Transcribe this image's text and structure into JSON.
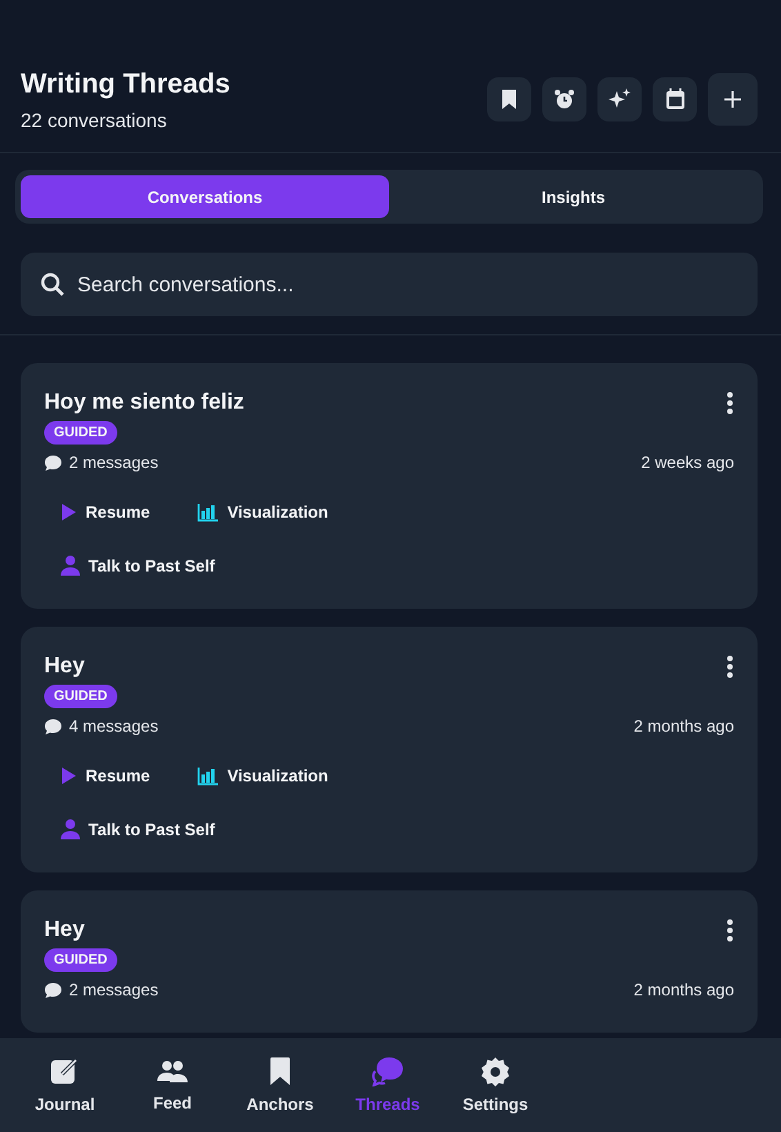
{
  "header": {
    "title": "Writing Threads",
    "subtitle": "22 conversations",
    "actions": [
      {
        "kind": "bookmark"
      },
      {
        "kind": "alarm"
      },
      {
        "kind": "sparkle"
      },
      {
        "kind": "calendar"
      },
      {
        "kind": "plus"
      }
    ]
  },
  "tabs": [
    {
      "label": "Conversations",
      "selected": true
    },
    {
      "label": "Insights",
      "selected": false
    }
  ],
  "search": {
    "placeholder": "Search conversations..."
  },
  "threads": [
    {
      "title": "Hoy me siento feliz",
      "badge": "GUIDED",
      "messages": "2 messages",
      "time": "2 weeks ago",
      "actions": [
        {
          "kind": "resume",
          "label": "Resume"
        },
        {
          "kind": "chart",
          "label": "Visualization"
        },
        {
          "kind": "person",
          "label": "Talk to Past Self"
        }
      ]
    },
    {
      "title": "Hey",
      "badge": "GUIDED",
      "messages": "4 messages",
      "time": "2 months ago",
      "actions": [
        {
          "kind": "resume",
          "label": "Resume"
        },
        {
          "kind": "chart",
          "label": "Visualization"
        },
        {
          "kind": "person",
          "label": "Talk to Past Self"
        }
      ]
    },
    {
      "title": "Hey",
      "badge": "GUIDED",
      "messages": "2 messages",
      "time": "2 months ago"
    }
  ],
  "nav": [
    {
      "kind": "journal",
      "label": "Journal",
      "selected": false
    },
    {
      "kind": "feed",
      "label": "Feed",
      "selected": false
    },
    {
      "kind": "anchors",
      "label": "Anchors",
      "selected": false
    },
    {
      "kind": "threads",
      "label": "Threads",
      "selected": true
    },
    {
      "kind": "settings",
      "label": "Settings",
      "selected": false
    }
  ]
}
